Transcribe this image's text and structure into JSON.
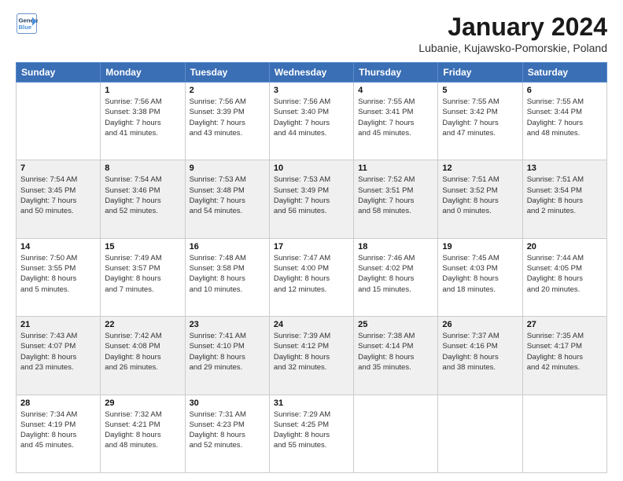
{
  "logo": {
    "line1": "General",
    "line2": "Blue"
  },
  "title": "January 2024",
  "location": "Lubanie, Kujawsko-Pomorskie, Poland",
  "weekdays": [
    "Sunday",
    "Monday",
    "Tuesday",
    "Wednesday",
    "Thursday",
    "Friday",
    "Saturday"
  ],
  "weeks": [
    [
      {
        "day": "",
        "info": ""
      },
      {
        "day": "1",
        "info": "Sunrise: 7:56 AM\nSunset: 3:38 PM\nDaylight: 7 hours\nand 41 minutes."
      },
      {
        "day": "2",
        "info": "Sunrise: 7:56 AM\nSunset: 3:39 PM\nDaylight: 7 hours\nand 43 minutes."
      },
      {
        "day": "3",
        "info": "Sunrise: 7:56 AM\nSunset: 3:40 PM\nDaylight: 7 hours\nand 44 minutes."
      },
      {
        "day": "4",
        "info": "Sunrise: 7:55 AM\nSunset: 3:41 PM\nDaylight: 7 hours\nand 45 minutes."
      },
      {
        "day": "5",
        "info": "Sunrise: 7:55 AM\nSunset: 3:42 PM\nDaylight: 7 hours\nand 47 minutes."
      },
      {
        "day": "6",
        "info": "Sunrise: 7:55 AM\nSunset: 3:44 PM\nDaylight: 7 hours\nand 48 minutes."
      }
    ],
    [
      {
        "day": "7",
        "info": "Sunrise: 7:54 AM\nSunset: 3:45 PM\nDaylight: 7 hours\nand 50 minutes."
      },
      {
        "day": "8",
        "info": "Sunrise: 7:54 AM\nSunset: 3:46 PM\nDaylight: 7 hours\nand 52 minutes."
      },
      {
        "day": "9",
        "info": "Sunrise: 7:53 AM\nSunset: 3:48 PM\nDaylight: 7 hours\nand 54 minutes."
      },
      {
        "day": "10",
        "info": "Sunrise: 7:53 AM\nSunset: 3:49 PM\nDaylight: 7 hours\nand 56 minutes."
      },
      {
        "day": "11",
        "info": "Sunrise: 7:52 AM\nSunset: 3:51 PM\nDaylight: 7 hours\nand 58 minutes."
      },
      {
        "day": "12",
        "info": "Sunrise: 7:51 AM\nSunset: 3:52 PM\nDaylight: 8 hours\nand 0 minutes."
      },
      {
        "day": "13",
        "info": "Sunrise: 7:51 AM\nSunset: 3:54 PM\nDaylight: 8 hours\nand 2 minutes."
      }
    ],
    [
      {
        "day": "14",
        "info": "Sunrise: 7:50 AM\nSunset: 3:55 PM\nDaylight: 8 hours\nand 5 minutes."
      },
      {
        "day": "15",
        "info": "Sunrise: 7:49 AM\nSunset: 3:57 PM\nDaylight: 8 hours\nand 7 minutes."
      },
      {
        "day": "16",
        "info": "Sunrise: 7:48 AM\nSunset: 3:58 PM\nDaylight: 8 hours\nand 10 minutes."
      },
      {
        "day": "17",
        "info": "Sunrise: 7:47 AM\nSunset: 4:00 PM\nDaylight: 8 hours\nand 12 minutes."
      },
      {
        "day": "18",
        "info": "Sunrise: 7:46 AM\nSunset: 4:02 PM\nDaylight: 8 hours\nand 15 minutes."
      },
      {
        "day": "19",
        "info": "Sunrise: 7:45 AM\nSunset: 4:03 PM\nDaylight: 8 hours\nand 18 minutes."
      },
      {
        "day": "20",
        "info": "Sunrise: 7:44 AM\nSunset: 4:05 PM\nDaylight: 8 hours\nand 20 minutes."
      }
    ],
    [
      {
        "day": "21",
        "info": "Sunrise: 7:43 AM\nSunset: 4:07 PM\nDaylight: 8 hours\nand 23 minutes."
      },
      {
        "day": "22",
        "info": "Sunrise: 7:42 AM\nSunset: 4:08 PM\nDaylight: 8 hours\nand 26 minutes."
      },
      {
        "day": "23",
        "info": "Sunrise: 7:41 AM\nSunset: 4:10 PM\nDaylight: 8 hours\nand 29 minutes."
      },
      {
        "day": "24",
        "info": "Sunrise: 7:39 AM\nSunset: 4:12 PM\nDaylight: 8 hours\nand 32 minutes."
      },
      {
        "day": "25",
        "info": "Sunrise: 7:38 AM\nSunset: 4:14 PM\nDaylight: 8 hours\nand 35 minutes."
      },
      {
        "day": "26",
        "info": "Sunrise: 7:37 AM\nSunset: 4:16 PM\nDaylight: 8 hours\nand 38 minutes."
      },
      {
        "day": "27",
        "info": "Sunrise: 7:35 AM\nSunset: 4:17 PM\nDaylight: 8 hours\nand 42 minutes."
      }
    ],
    [
      {
        "day": "28",
        "info": "Sunrise: 7:34 AM\nSunset: 4:19 PM\nDaylight: 8 hours\nand 45 minutes."
      },
      {
        "day": "29",
        "info": "Sunrise: 7:32 AM\nSunset: 4:21 PM\nDaylight: 8 hours\nand 48 minutes."
      },
      {
        "day": "30",
        "info": "Sunrise: 7:31 AM\nSunset: 4:23 PM\nDaylight: 8 hours\nand 52 minutes."
      },
      {
        "day": "31",
        "info": "Sunrise: 7:29 AM\nSunset: 4:25 PM\nDaylight: 8 hours\nand 55 minutes."
      },
      {
        "day": "",
        "info": ""
      },
      {
        "day": "",
        "info": ""
      },
      {
        "day": "",
        "info": ""
      }
    ]
  ]
}
